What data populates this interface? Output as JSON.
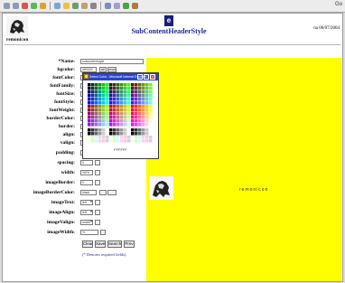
{
  "toolbar": {
    "right_text": "Go"
  },
  "header": {
    "brand": "remonicon",
    "icon_letter": "e",
    "title": "SubContentHeaderStyle",
    "date": "na 06/07/2004"
  },
  "form": {
    "fields": [
      {
        "label": "*Name:",
        "value": "subcontentstyle",
        "kind": "text"
      },
      {
        "label": "bgcolor:",
        "value": "#ff0000",
        "kind": "color",
        "btn1": "sel",
        "btn2": "reset"
      },
      {
        "label": "fontColor:",
        "value": "#333333",
        "kind": "color"
      },
      {
        "label": "fontFamily:",
        "value": "ver",
        "kind": "text"
      },
      {
        "label": "fontSize:",
        "value": "7x",
        "kind": "text"
      },
      {
        "label": "fontStyle:",
        "value": "norma",
        "kind": "select"
      },
      {
        "label": "fontWeight:",
        "value": "norma",
        "kind": "select"
      },
      {
        "label": "borderColor:",
        "value": "black",
        "kind": "text"
      },
      {
        "label": "border:",
        "value": "0",
        "kind": "text"
      },
      {
        "label": "align:",
        "value": "cente",
        "kind": "select"
      },
      {
        "label": "valign:",
        "value": "middl",
        "kind": "select"
      },
      {
        "label": "padding:",
        "value": "0",
        "kind": "small"
      },
      {
        "label": "spacing:",
        "value": "0",
        "kind": "small"
      },
      {
        "label": "width:",
        "value": "%0%",
        "kind": "small"
      },
      {
        "label": "imageBorder:",
        "value": "0",
        "kind": "small"
      },
      {
        "label": "imageBorderColor:",
        "value": "black",
        "kind": "color2"
      },
      {
        "label": "imageText:",
        "value": "left",
        "kind": "imgsel"
      },
      {
        "label": "imageAlign:",
        "value": "left",
        "kind": "imgsel"
      },
      {
        "label": "imageValign:",
        "value": "middl",
        "kind": "imgsel"
      },
      {
        "label": "imageWidth:",
        "value": "%",
        "kind": "imgsel"
      }
    ],
    "buttons": [
      "Clear",
      "Save",
      "Search",
      "Prev"
    ],
    "note": "(* Denotes required fields)"
  },
  "preview": {
    "text": "remonicon"
  },
  "picker": {
    "title": "Select Color - Microsoft Internet Explorer",
    "footer": "FFFFFF",
    "colors": {
      "grays": [
        "#000000",
        "#333333",
        "#666666",
        "#999999",
        "#cccccc",
        "#ffffff"
      ],
      "pastels": [
        "#ffffcc",
        "#ccffcc",
        "#ccffff",
        "#ffccff",
        "#ffcccc",
        "#ccccff"
      ]
    }
  }
}
